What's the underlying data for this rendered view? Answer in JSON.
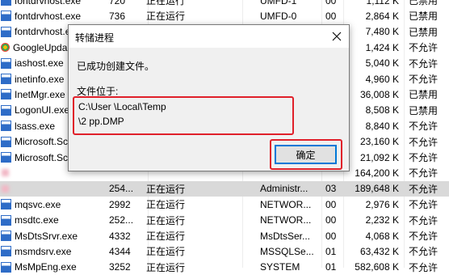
{
  "processes": [
    {
      "name": "fontdrvhost.exe",
      "pid": "720",
      "status": "正在运行",
      "user": "UMFD-1",
      "cpu": "00",
      "mem": "1,112 K",
      "desc": "已禁用",
      "icon": "process-icon"
    },
    {
      "name": "fontdrvhost.exe",
      "pid": "736",
      "status": "正在运行",
      "user": "UMFD-0",
      "cpu": "00",
      "mem": "2,864 K",
      "desc": "已禁用",
      "icon": "process-icon"
    },
    {
      "name": "fontdrvhost.exe",
      "pid": "",
      "status": "",
      "user": "",
      "cpu": "",
      "mem": "7,480 K",
      "desc": "已禁用",
      "icon": "process-icon"
    },
    {
      "name": "GoogleUpda",
      "pid": "",
      "status": "",
      "user": "",
      "cpu": "",
      "mem": "1,424 K",
      "desc": "不允许",
      "icon": "google-icon"
    },
    {
      "name": "iashost.exe",
      "pid": "",
      "status": "",
      "user": "",
      "cpu": "",
      "mem": "5,040 K",
      "desc": "不允许",
      "icon": "process-icon"
    },
    {
      "name": "inetinfo.exe",
      "pid": "",
      "status": "",
      "user": "",
      "cpu": "",
      "mem": "4,960 K",
      "desc": "不允许",
      "icon": "process-icon"
    },
    {
      "name": "InetMgr.exe",
      "pid": "",
      "status": "",
      "user": "",
      "cpu": "",
      "mem": "36,008 K",
      "desc": "已禁用",
      "icon": "process-icon"
    },
    {
      "name": "LogonUI.exe",
      "pid": "",
      "status": "",
      "user": "",
      "cpu": "",
      "mem": "8,508 K",
      "desc": "已禁用",
      "icon": "process-icon"
    },
    {
      "name": "lsass.exe",
      "pid": "",
      "status": "",
      "user": "",
      "cpu": "",
      "mem": "8,840 K",
      "desc": "不允许",
      "icon": "process-icon"
    },
    {
      "name": "Microsoft.Sc",
      "pid": "",
      "status": "",
      "user": "",
      "cpu": "",
      "mem": "23,160 K",
      "desc": "不允许",
      "icon": "process-icon"
    },
    {
      "name": "Microsoft.Sc",
      "pid": "",
      "status": "",
      "user": "",
      "cpu": "",
      "mem": "21,092 K",
      "desc": "不允许",
      "icon": "process-icon"
    },
    {
      "name": "",
      "pid": "",
      "status": "",
      "user": "",
      "cpu": "",
      "mem": "164,200 K",
      "desc": "不允许",
      "icon": "blurred"
    },
    {
      "name": "",
      "pid": "254...",
      "status": "正在运行",
      "user": "Administr...",
      "cpu": "03",
      "mem": "189,648 K",
      "desc": "不允许",
      "icon": "blurred",
      "selected": true
    },
    {
      "name": "mqsvc.exe",
      "pid": "2992",
      "status": "正在运行",
      "user": "NETWOR...",
      "cpu": "00",
      "mem": "2,976 K",
      "desc": "不允许",
      "icon": "process-icon"
    },
    {
      "name": "msdtc.exe",
      "pid": "252...",
      "status": "正在运行",
      "user": "NETWOR...",
      "cpu": "00",
      "mem": "2,232 K",
      "desc": "不允许",
      "icon": "process-icon"
    },
    {
      "name": "MsDtsSrvr.exe",
      "pid": "4332",
      "status": "正在运行",
      "user": "MsDtsSer...",
      "cpu": "00",
      "mem": "4,068 K",
      "desc": "不允许",
      "icon": "process-icon"
    },
    {
      "name": "msmdsrv.exe",
      "pid": "4344",
      "status": "正在运行",
      "user": "MSSQLSe...",
      "cpu": "01",
      "mem": "63,432 K",
      "desc": "不允许",
      "icon": "process-icon"
    },
    {
      "name": "MsMpEng.exe",
      "pid": "3252",
      "status": "正在运行",
      "user": "SYSTEM",
      "cpu": "01",
      "mem": "582,608 K",
      "desc": "不允许",
      "icon": "process-icon"
    }
  ],
  "dialog": {
    "title": "转储进程",
    "message": "已成功创建文件。",
    "location_label": "文件位于:",
    "path_line1": "C:\\User                             \\Local\\Temp",
    "path_line2": "\\2                                    pp.DMP",
    "ok_label": "确定"
  }
}
